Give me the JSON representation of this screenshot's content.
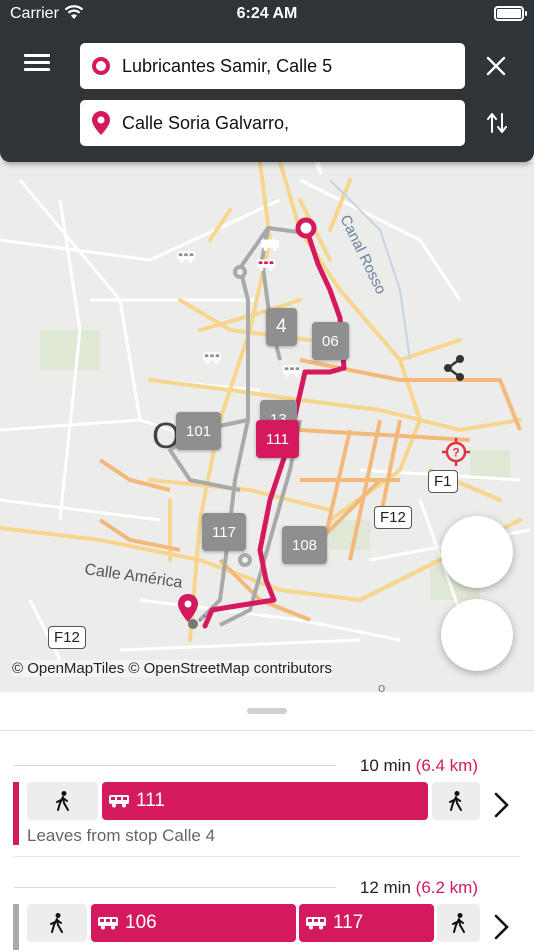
{
  "status_bar": {
    "carrier": "Carrier",
    "time": "6:24 AM"
  },
  "search": {
    "origin": "Lubricantes Samir, Calle 5",
    "destination": "Calle Soria Galvarro,"
  },
  "map": {
    "place_labels": [
      "Canal Rosso",
      "Calle América",
      "O",
      "o"
    ],
    "road_labels": [
      "F1",
      "F12",
      "F12"
    ],
    "bus_labels": [
      "4",
      "06",
      "13",
      "101",
      "111",
      "117",
      "108"
    ],
    "attribution": "© OpenMapTiles © OpenStreetMap contributors"
  },
  "itineraries": [
    {
      "duration": "10 min",
      "distance": "(6.4 km)",
      "routes": [
        "111"
      ],
      "leaves": "Leaves from stop Calle 4"
    },
    {
      "duration": "12 min",
      "distance": "(6.2 km)",
      "routes": [
        "106",
        "117"
      ]
    }
  ],
  "colors": {
    "accent": "#d4195e",
    "header": "#2f3439",
    "bus_gray": "#8f8f8f"
  },
  "icons": [
    "menu-icon",
    "origin-ring-icon",
    "destination-pin-icon",
    "close-icon",
    "swap-icon",
    "bus-icon",
    "walk-icon",
    "share-icon",
    "locate-icon",
    "chevron-right-icon"
  ]
}
